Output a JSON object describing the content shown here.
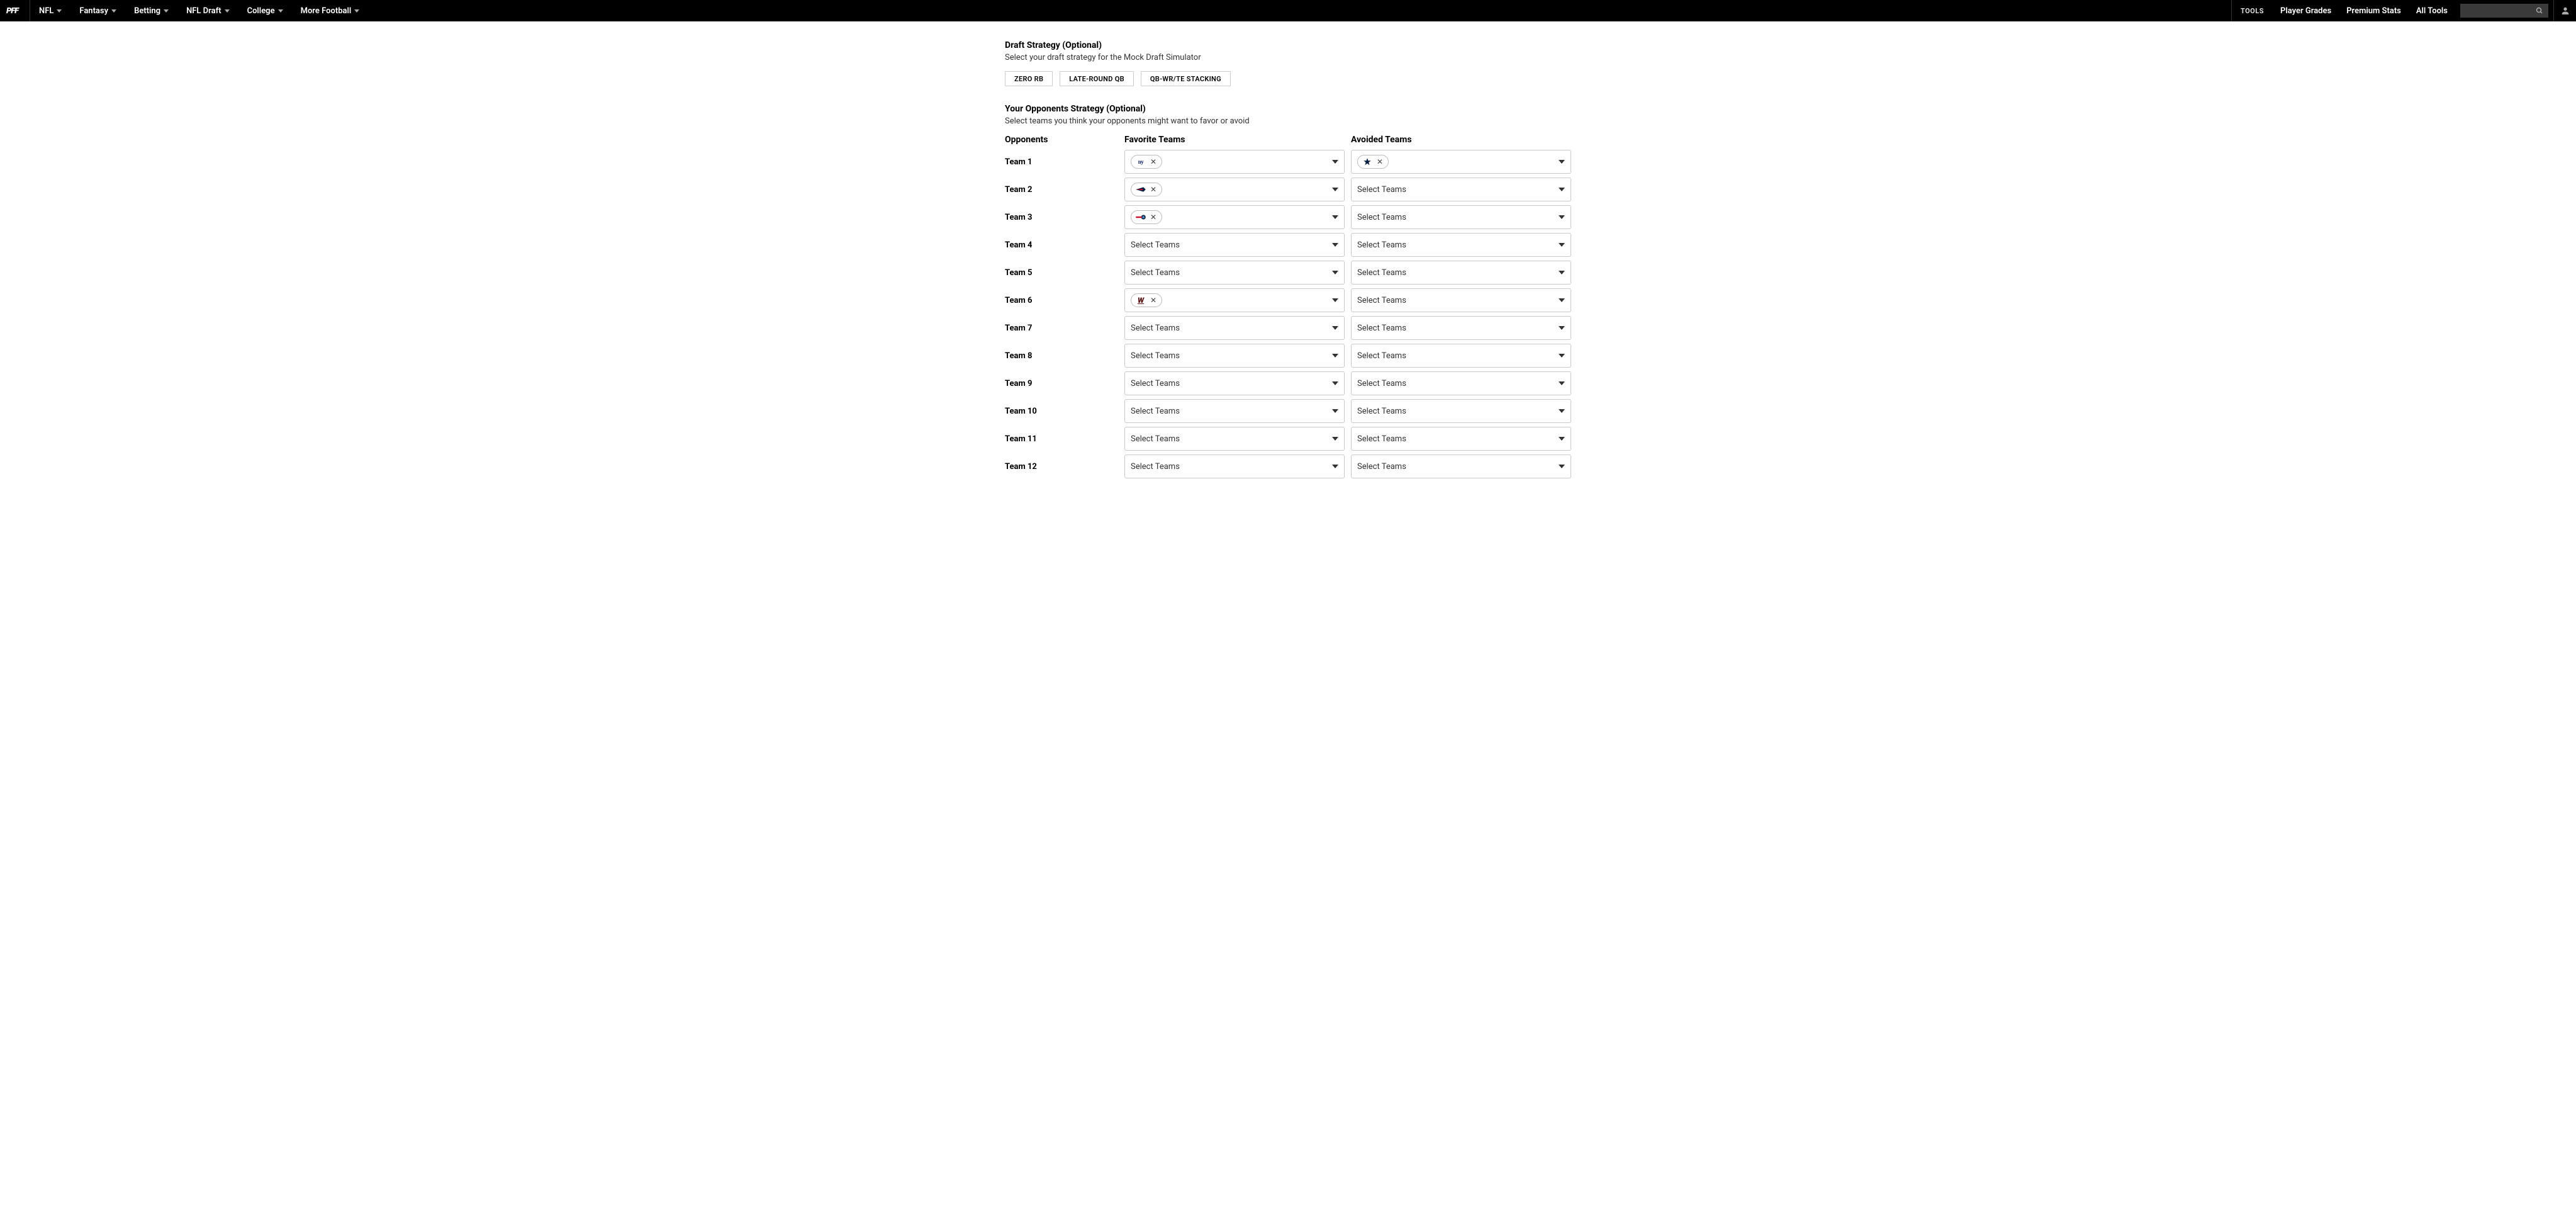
{
  "header": {
    "logo": "PFF",
    "nav_left": [
      "NFL",
      "Fantasy",
      "Betting",
      "NFL Draft",
      "College",
      "More Football"
    ],
    "tools_label": "TOOLS",
    "nav_right": [
      "Player Grades",
      "Premium Stats",
      "All Tools"
    ]
  },
  "draft_strategy": {
    "title": "Draft Strategy (Optional)",
    "subtitle": "Select your draft strategy for the Mock Draft Simulator",
    "options": [
      "ZERO RB",
      "LATE-ROUND QB",
      "QB-WR/TE STACKING"
    ]
  },
  "opponents_strategy": {
    "title": "Your Opponents Strategy (Optional)",
    "subtitle": "Select teams you think your opponents might want to favor or avoid",
    "col_opponents": "Opponents",
    "col_favorite": "Favorite Teams",
    "col_avoided": "Avoided Teams",
    "placeholder": "Select Teams",
    "rows": [
      {
        "label": "Team 1",
        "fav_team": "nyg",
        "avd_team": "dal"
      },
      {
        "label": "Team 2",
        "fav_team": "ne"
      },
      {
        "label": "Team 3",
        "fav_team": "ten"
      },
      {
        "label": "Team 4"
      },
      {
        "label": "Team 5"
      },
      {
        "label": "Team 6",
        "fav_team": "was"
      },
      {
        "label": "Team 7"
      },
      {
        "label": "Team 8"
      },
      {
        "label": "Team 9"
      },
      {
        "label": "Team 10"
      },
      {
        "label": "Team 11"
      },
      {
        "label": "Team 12"
      }
    ]
  }
}
